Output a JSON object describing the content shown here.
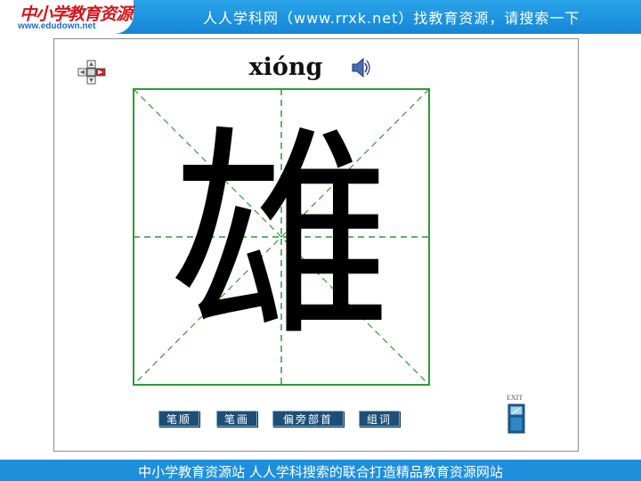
{
  "header": {
    "logo_text": "中小学教育资源",
    "logo_url": "www.edudown.net",
    "slogan": "人人学科网（www.rrxk.net）找教育资源，请搜索一下"
  },
  "footer": {
    "text": "中小学教育资源站 人人学科搜索的联合打造精品教育资源网站"
  },
  "lesson": {
    "pinyin": "xióng",
    "character": "雄"
  },
  "buttons": [
    {
      "label": "笔顺"
    },
    {
      "label": "笔画"
    },
    {
      "label": "偏旁部首"
    },
    {
      "label": "组词"
    }
  ],
  "exit": {
    "label": "EXIT"
  },
  "colors": {
    "grid_green": "#2f9a3a",
    "top_bar": "#1f8fdc",
    "button_bg": "#1d4f76"
  },
  "icons": {
    "speaker": "speaker-icon",
    "nav": "nav-arrows-icon",
    "exit": "exit-door-icon"
  }
}
